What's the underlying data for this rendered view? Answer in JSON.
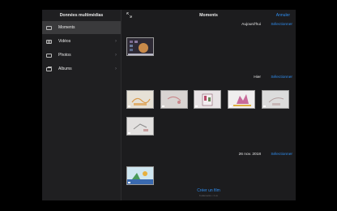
{
  "sidebar": {
    "title": "Données multimédias",
    "items": [
      {
        "label": "Moments",
        "icon": "photo-icon"
      },
      {
        "label": "Vidéos",
        "icon": "film-icon"
      },
      {
        "label": "Photos",
        "icon": "photo-icon"
      },
      {
        "label": "Albums",
        "icon": "album-icon"
      }
    ]
  },
  "header": {
    "title": "Moments",
    "cancel_label": "Annuler"
  },
  "sections": [
    {
      "date": "Aujourd'hui",
      "select_label": "Sélectionner"
    },
    {
      "date": "Hier",
      "select_label": "Sélectionner"
    },
    {
      "date": "26 nov. 2018",
      "select_label": "Sélectionner"
    }
  ],
  "footer": {
    "create_movie_label": "Créer un film",
    "create_movie_sub": "6 éléments • 1 vo"
  },
  "colors": {
    "accent": "#2f8ef0",
    "background": "#1c1c1e",
    "sidebar_selected": "#3a3a3c"
  }
}
